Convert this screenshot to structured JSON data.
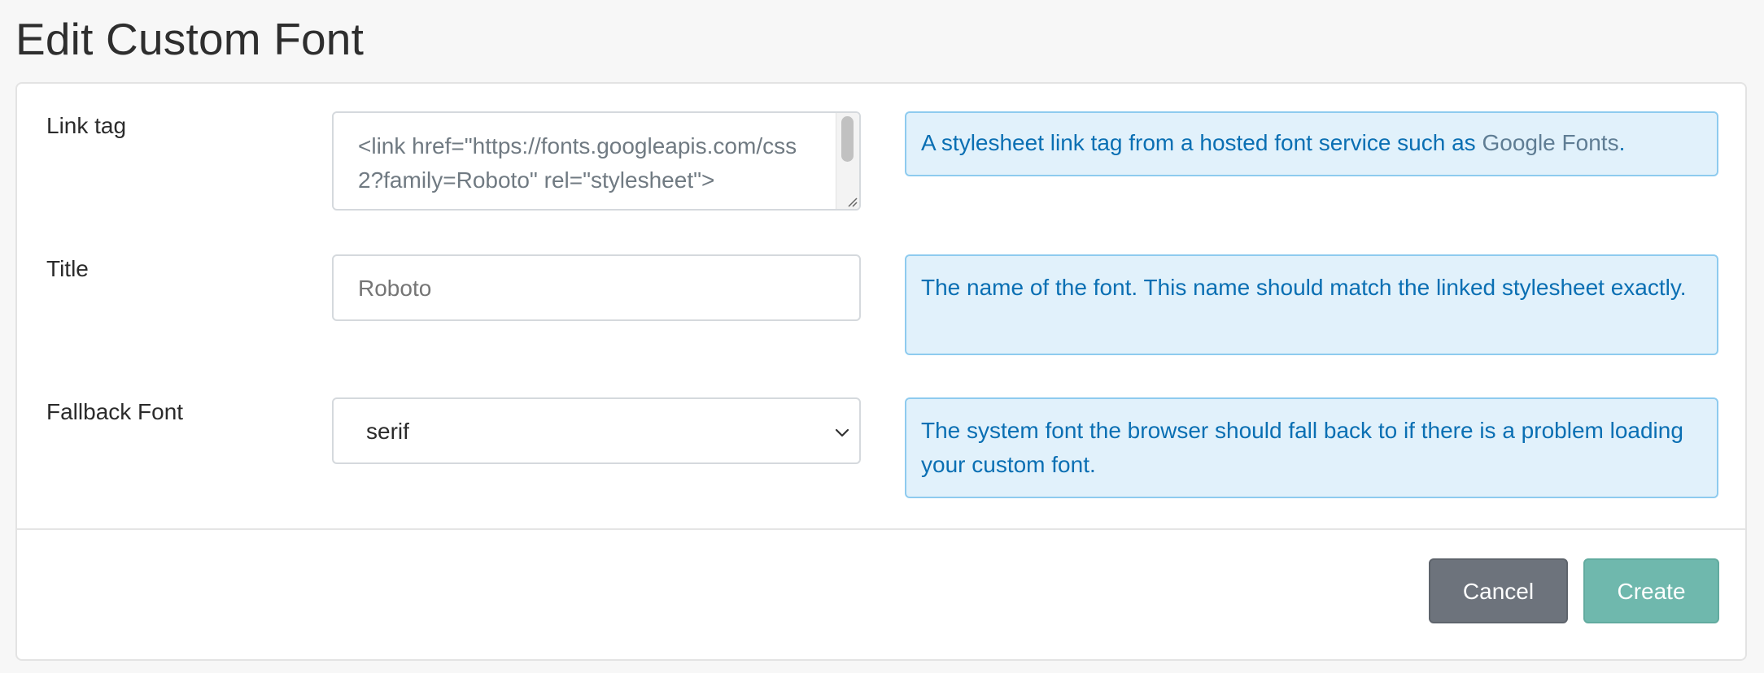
{
  "page": {
    "title": "Edit Custom Font"
  },
  "form": {
    "link_tag": {
      "label": "Link tag",
      "value": "<link href=\"https://fonts.googleapis.com/css2?family=Roboto\" rel=\"stylesheet\">",
      "help_prefix": "A stylesheet link tag from a hosted font service such as ",
      "help_link": "Google Fonts",
      "help_suffix": "."
    },
    "title": {
      "label": "Title",
      "placeholder": "Roboto",
      "value": "",
      "help": "The name of the font. This name should match the linked stylesheet exactly."
    },
    "fallback_font": {
      "label": "Fallback Font",
      "selected": "serif",
      "help": "The system font the browser should fall back to if there is a problem loading your custom font."
    }
  },
  "actions": {
    "cancel_label": "Cancel",
    "create_label": "Create"
  },
  "colors": {
    "help_background": "#e1f1fb",
    "help_border": "#8ecbef",
    "help_text": "#0a6fb3",
    "cancel_button": "#6d737c",
    "create_button": "#6fb8ad"
  },
  "icons": {
    "select_chevron": "chevron-down-icon",
    "textarea_resize": "resize-grip-icon"
  }
}
